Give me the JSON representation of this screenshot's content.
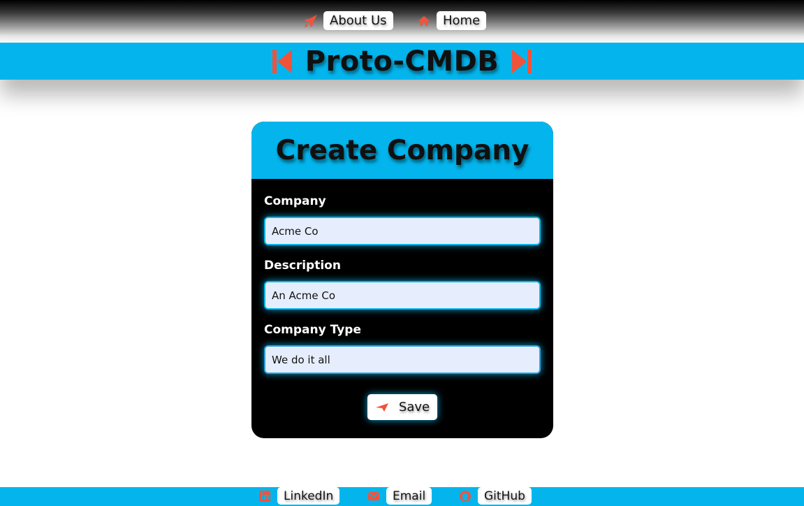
{
  "nav": {
    "about": {
      "label": "About Us",
      "icon": "rocket-icon"
    },
    "home": {
      "label": "Home",
      "icon": "home-icon"
    }
  },
  "banner": {
    "title": "Proto-CMDB",
    "left_icon": "skip-back-icon",
    "right_icon": "skip-forward-icon"
  },
  "form": {
    "title": "Create Company",
    "fields": [
      {
        "label": "Company",
        "value": "Acme Co"
      },
      {
        "label": "Description",
        "value": "An Acme Co"
      },
      {
        "label": "Company Type",
        "value": "We do it all"
      }
    ],
    "save_label": "Save",
    "save_icon": "paper-plane-icon"
  },
  "footer": {
    "linkedin": {
      "label": "LinkedIn",
      "icon": "linkedin-icon"
    },
    "email": {
      "label": "Email",
      "icon": "envelope-icon"
    },
    "github": {
      "label": "GitHub",
      "icon": "github-icon"
    }
  },
  "colors": {
    "accent": "#03b5ec",
    "icon": "#f0533a",
    "card": "#000000",
    "input_bg": "#e6eefd"
  }
}
